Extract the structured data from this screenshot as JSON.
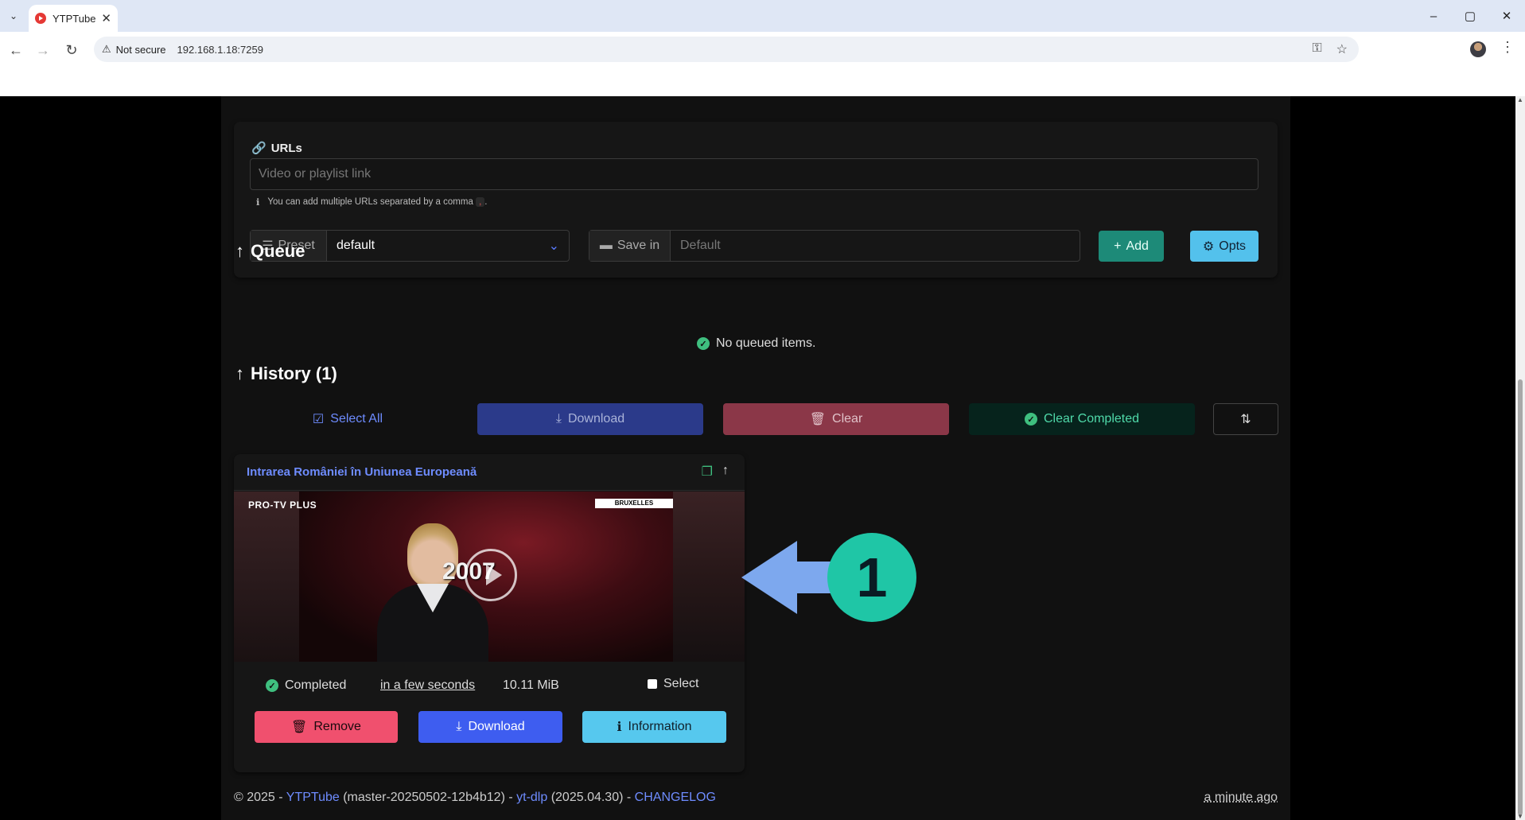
{
  "browser": {
    "tab_title": "YTPTube",
    "tab_close": "✕",
    "security_label": "Not secure",
    "url": "192.168.1.18:7259",
    "window_controls": {
      "minimize": "–",
      "maximize": "▢",
      "close": "✕"
    }
  },
  "form": {
    "urls_label": "URLs",
    "url_placeholder": "Video or playlist link",
    "url_help": "You can add multiple URLs separated by a comma",
    "url_help_comma": ",",
    "url_help_end": ".",
    "preset_label": "Preset",
    "preset_value": "default",
    "save_in_label": "Save in",
    "save_in_placeholder": "Default",
    "add_label": "Add",
    "opts_label": "Opts"
  },
  "queue": {
    "title": "Queue",
    "empty_message": "No queued items."
  },
  "history": {
    "title": "History (1)",
    "select_all": "Select All",
    "download": "Download",
    "clear": "Clear",
    "clear_completed": "Clear Completed",
    "sort_icon": "sort-icon"
  },
  "item": {
    "title": "Intrarea României în Uniunea Europeană",
    "thumbnail": {
      "channel_logo": "PRO-TV PLUS",
      "location_tag": "BRUXELLES",
      "year_overlay": "2007"
    },
    "status": "Completed",
    "time": "in a few seconds",
    "size": "10.11 MiB",
    "select_label": "Select",
    "remove": "Remove",
    "download": "Download",
    "information": "Information"
  },
  "footer": {
    "copyright": "© 2025 - ",
    "app_name": "YTPTube",
    "version": " (master-20250502-12b4b12) - ",
    "ytdlp": "yt-dlp",
    "ytdlp_version": " (2025.04.30) - ",
    "changelog": "CHANGELOG",
    "updated": "a minute ago"
  },
  "annotation": {
    "number": "1"
  },
  "colors": {
    "accent": "#6e8cff",
    "success": "#3fbf7f",
    "danger": "#f0506e",
    "info": "#56c8ee",
    "annotation_circle": "#1fc6a6",
    "annotation_arrow": "#7da8ee"
  }
}
